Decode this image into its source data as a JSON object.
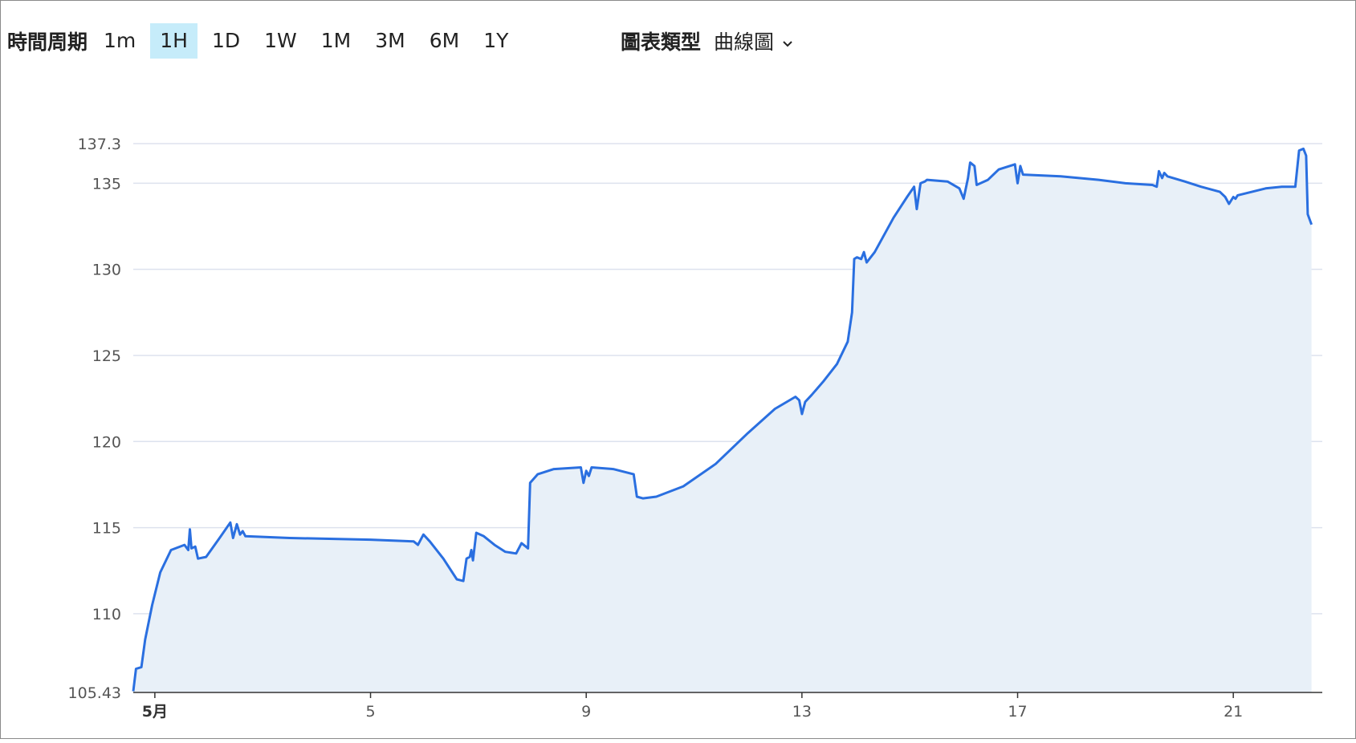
{
  "toolbar": {
    "period_label": "時間周期",
    "periods": [
      "1m",
      "1H",
      "1D",
      "1W",
      "1M",
      "3M",
      "6M",
      "1Y"
    ],
    "active_period": "1H",
    "chart_type_label": "圖表類型",
    "chart_type_value": "曲線圖",
    "chevron_icon": "chevron-down-icon"
  },
  "colors": {
    "line": "#2a6fe0",
    "area": "#e8f0f8",
    "grid": "#dde2ee",
    "active_tab": "#c6ecfa"
  },
  "chart_data": {
    "type": "area",
    "title": "",
    "xlabel": "",
    "ylabel": "",
    "ylim": [
      105.43,
      137.3
    ],
    "xlim": [
      0.6,
      22.65
    ],
    "y_ticks": [
      105.43,
      110,
      115,
      120,
      125,
      130,
      135,
      137.3
    ],
    "y_tick_labels": [
      "105.43",
      "110",
      "115",
      "120",
      "125",
      "130",
      "135",
      "137.3"
    ],
    "x_ticks": [
      1,
      5,
      9,
      13,
      17,
      21
    ],
    "x_tick_labels": [
      "5月",
      "5",
      "9",
      "13",
      "17",
      "21"
    ],
    "grid": true,
    "series": [
      {
        "points": [
          [
            0.6,
            105.5
          ],
          [
            0.65,
            106.8
          ],
          [
            0.75,
            106.9
          ],
          [
            0.82,
            108.5
          ],
          [
            0.95,
            110.5
          ],
          [
            1.1,
            112.4
          ],
          [
            1.3,
            113.7
          ],
          [
            1.55,
            114.0
          ],
          [
            1.62,
            113.7
          ],
          [
            1.65,
            114.9
          ],
          [
            1.68,
            113.8
          ],
          [
            1.75,
            113.9
          ],
          [
            1.8,
            113.2
          ],
          [
            1.95,
            113.3
          ],
          [
            2.2,
            114.4
          ],
          [
            2.4,
            115.3
          ],
          [
            2.45,
            114.4
          ],
          [
            2.52,
            115.2
          ],
          [
            2.58,
            114.6
          ],
          [
            2.63,
            114.8
          ],
          [
            2.68,
            114.5
          ],
          [
            3.5,
            114.4
          ],
          [
            5.0,
            114.3
          ],
          [
            5.8,
            114.2
          ],
          [
            5.88,
            114.0
          ],
          [
            5.98,
            114.6
          ],
          [
            6.1,
            114.2
          ],
          [
            6.35,
            113.2
          ],
          [
            6.6,
            112.0
          ],
          [
            6.72,
            111.9
          ],
          [
            6.78,
            113.2
          ],
          [
            6.84,
            113.3
          ],
          [
            6.87,
            113.7
          ],
          [
            6.9,
            113.1
          ],
          [
            6.96,
            114.7
          ],
          [
            7.1,
            114.5
          ],
          [
            7.3,
            114.0
          ],
          [
            7.5,
            113.6
          ],
          [
            7.7,
            113.5
          ],
          [
            7.8,
            114.1
          ],
          [
            7.88,
            113.9
          ],
          [
            7.92,
            113.8
          ],
          [
            7.96,
            117.6
          ],
          [
            8.1,
            118.1
          ],
          [
            8.4,
            118.4
          ],
          [
            8.9,
            118.5
          ],
          [
            8.95,
            117.6
          ],
          [
            9.0,
            118.3
          ],
          [
            9.05,
            118.0
          ],
          [
            9.1,
            118.5
          ],
          [
            9.5,
            118.4
          ],
          [
            9.88,
            118.1
          ],
          [
            9.94,
            116.8
          ],
          [
            10.05,
            116.7
          ],
          [
            10.3,
            116.8
          ],
          [
            10.8,
            117.4
          ],
          [
            11.4,
            118.7
          ],
          [
            12.0,
            120.5
          ],
          [
            12.5,
            121.9
          ],
          [
            12.88,
            122.6
          ],
          [
            12.95,
            122.4
          ],
          [
            13.0,
            121.6
          ],
          [
            13.06,
            122.3
          ],
          [
            13.18,
            122.7
          ],
          [
            13.4,
            123.5
          ],
          [
            13.65,
            124.5
          ],
          [
            13.85,
            125.8
          ],
          [
            13.93,
            127.5
          ],
          [
            13.97,
            130.6
          ],
          [
            14.02,
            130.7
          ],
          [
            14.1,
            130.6
          ],
          [
            14.15,
            131.0
          ],
          [
            14.2,
            130.4
          ],
          [
            14.35,
            131.0
          ],
          [
            14.7,
            133.0
          ],
          [
            14.95,
            134.2
          ],
          [
            15.08,
            134.8
          ],
          [
            15.13,
            133.5
          ],
          [
            15.2,
            135.0
          ],
          [
            15.28,
            135.1
          ],
          [
            15.32,
            135.2
          ],
          [
            15.7,
            135.1
          ],
          [
            15.92,
            134.7
          ],
          [
            16.0,
            134.1
          ],
          [
            16.08,
            135.3
          ],
          [
            16.12,
            136.2
          ],
          [
            16.2,
            136.0
          ],
          [
            16.24,
            134.9
          ],
          [
            16.45,
            135.2
          ],
          [
            16.65,
            135.8
          ],
          [
            16.95,
            136.1
          ],
          [
            16.98,
            135.4
          ],
          [
            17.0,
            135.0
          ],
          [
            17.05,
            136.0
          ],
          [
            17.1,
            135.5
          ],
          [
            17.8,
            135.4
          ],
          [
            18.5,
            135.2
          ],
          [
            19.0,
            135.0
          ],
          [
            19.5,
            134.9
          ],
          [
            19.58,
            134.8
          ],
          [
            19.62,
            135.7
          ],
          [
            19.68,
            135.3
          ],
          [
            19.72,
            135.6
          ],
          [
            19.78,
            135.4
          ],
          [
            20.1,
            135.1
          ],
          [
            20.4,
            134.8
          ],
          [
            20.75,
            134.5
          ],
          [
            20.85,
            134.2
          ],
          [
            20.92,
            133.8
          ],
          [
            21.0,
            134.2
          ],
          [
            21.04,
            134.1
          ],
          [
            21.08,
            134.3
          ],
          [
            21.6,
            134.7
          ],
          [
            21.9,
            134.8
          ],
          [
            22.15,
            134.8
          ],
          [
            22.22,
            136.9
          ],
          [
            22.3,
            137.0
          ],
          [
            22.35,
            136.6
          ],
          [
            22.38,
            133.2
          ],
          [
            22.45,
            132.6
          ]
        ]
      }
    ]
  }
}
